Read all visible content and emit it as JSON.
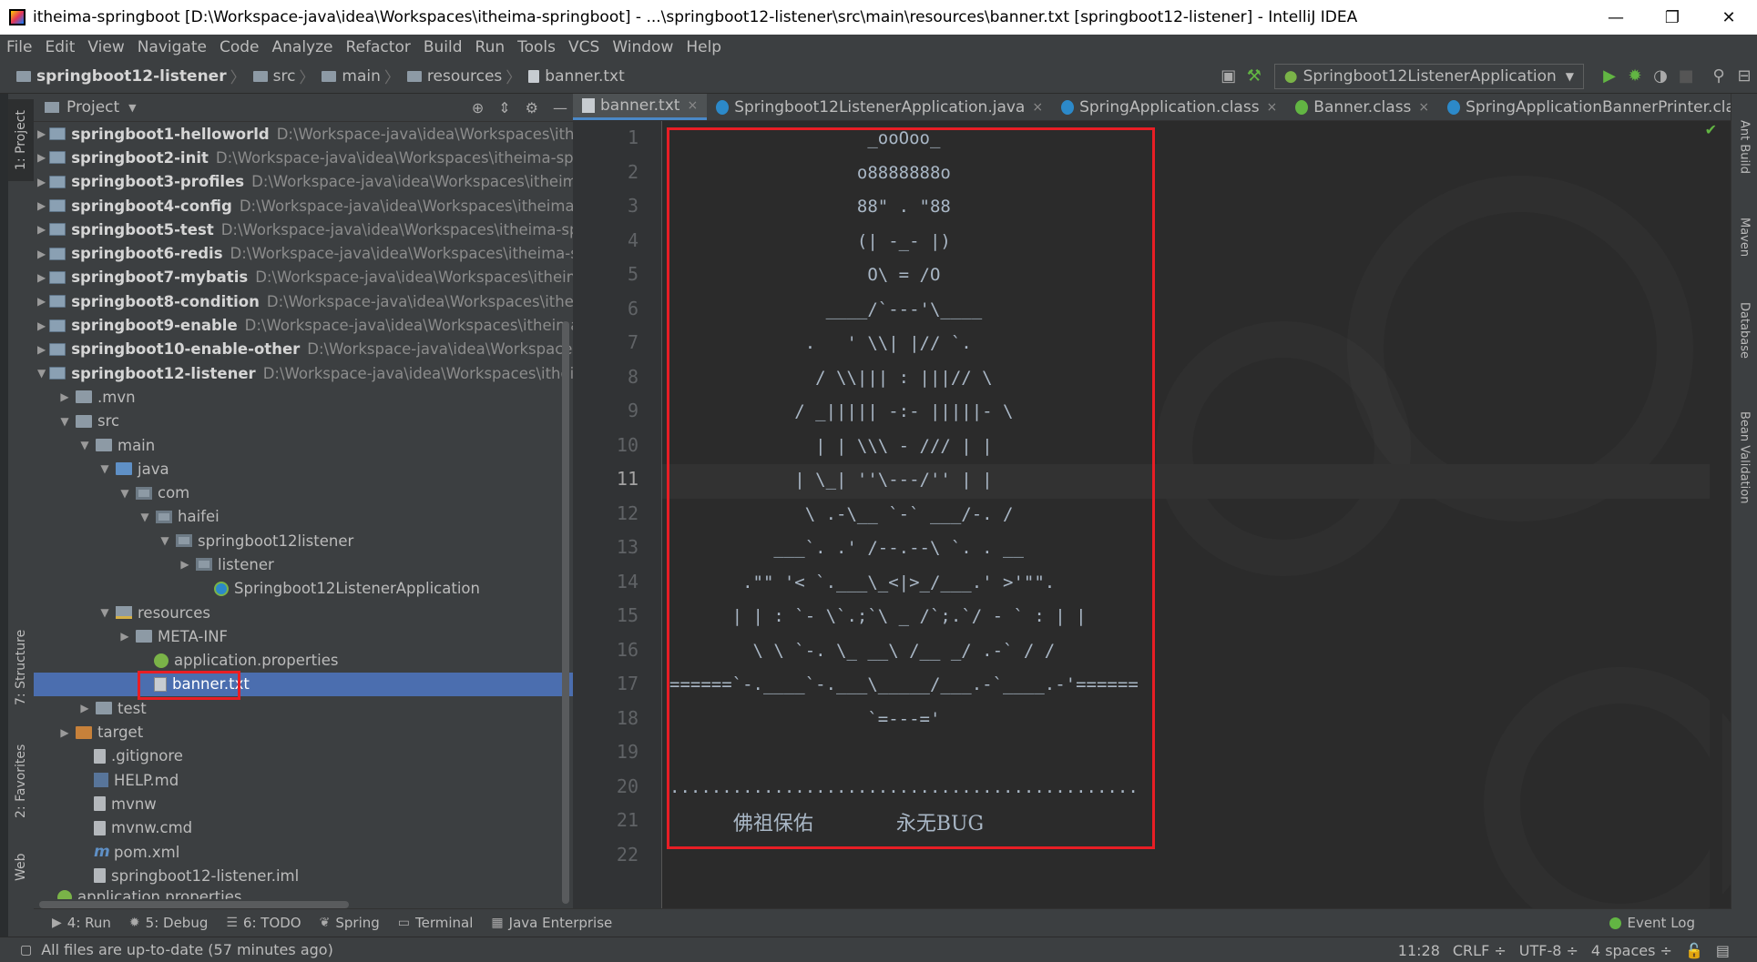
{
  "window": {
    "title": "itheima-springboot [D:\\Workspace-java\\idea\\Workspaces\\itheima-springboot] - ...\\springboot12-listener\\src\\main\\resources\\banner.txt [springboot12-listener] - IntelliJ IDEA",
    "minimize": "—",
    "maximize": "❐",
    "close": "✕"
  },
  "menu": [
    "File",
    "Edit",
    "View",
    "Navigate",
    "Code",
    "Analyze",
    "Refactor",
    "Build",
    "Run",
    "Tools",
    "VCS",
    "Window",
    "Help"
  ],
  "breadcrumbs": [
    "springboot12-listener",
    "src",
    "main",
    "resources",
    "banner.txt"
  ],
  "run_config": "Springboot12ListenerApplication",
  "left_tool_tabs": {
    "project": "1: Project",
    "structure": "7: Structure",
    "favorites": "2: Favorites",
    "web": "Web"
  },
  "right_tool_tabs": [
    "Ant Build",
    "Maven",
    "Database",
    "Bean Validation"
  ],
  "project_panel": {
    "title": "Project",
    "modules": [
      {
        "name": "springboot1-helloworld",
        "path": "D:\\Workspace-java\\idea\\Workspaces\\itheima-spri"
      },
      {
        "name": "springboot2-init",
        "path": "D:\\Workspace-java\\idea\\Workspaces\\itheima-springboot"
      },
      {
        "name": "springboot3-profiles",
        "path": "D:\\Workspace-java\\idea\\Workspaces\\itheima-springl"
      },
      {
        "name": "springboot4-config",
        "path": "D:\\Workspace-java\\idea\\Workspaces\\itheima-springb"
      },
      {
        "name": "springboot5-test",
        "path": "D:\\Workspace-java\\idea\\Workspaces\\itheima-springboo"
      },
      {
        "name": "springboot6-redis",
        "path": "D:\\Workspace-java\\idea\\Workspaces\\itheima-springboo"
      },
      {
        "name": "springboot7-mybatis",
        "path": "D:\\Workspace-java\\idea\\Workspaces\\itheima-spring"
      },
      {
        "name": "springboot8-condition",
        "path": "D:\\Workspace-java\\idea\\Workspaces\\itheima-sprir"
      },
      {
        "name": "springboot9-enable",
        "path": "D:\\Workspace-java\\idea\\Workspaces\\itheima-springb"
      },
      {
        "name": "springboot10-enable-other",
        "path": "D:\\Workspace-java\\idea\\Workspaces\\itheima-"
      },
      {
        "name": "springboot12-listener",
        "path": "D:\\Workspace-java\\idea\\Workspaces\\itheima-spring"
      }
    ],
    "files": {
      "mvn": ".mvn",
      "src": "src",
      "main": "main",
      "java": "java",
      "com": "com",
      "haifei": "haifei",
      "pkg": "springboot12listener",
      "listener": "listener",
      "app_class": "Springboot12ListenerApplication",
      "resources": "resources",
      "meta_inf": "META-INF",
      "app_props": "application.properties",
      "banner": "banner.txt",
      "test": "test",
      "target": "target",
      "gitignore": ".gitignore",
      "help": "HELP.md",
      "mvnw": "mvnw",
      "mvnw_cmd": "mvnw.cmd",
      "pom": "pom.xml",
      "iml": "springboot12-listener.iml",
      "partial": "application.properties"
    }
  },
  "editor_tabs": [
    {
      "label": "banner.txt",
      "active": true
    },
    {
      "label": "Springboot12ListenerApplication.java",
      "active": false
    },
    {
      "label": "SpringApplication.class",
      "active": false
    },
    {
      "label": "Banner.class",
      "active": false
    },
    {
      "label": "SpringApplicationBannerPrinter.class",
      "active": false
    }
  ],
  "tab_close": "×",
  "editor": {
    "current_line": 11,
    "line_numbers": [
      "1",
      "2",
      "3",
      "4",
      "5",
      "6",
      "7",
      "8",
      "9",
      "10",
      "11",
      "12",
      "13",
      "14",
      "15",
      "16",
      "17",
      "18",
      "19",
      "20",
      "21",
      "22"
    ],
    "lines": [
      "                   _ooOoo_",
      "                  o8888888o",
      "                  88\" . \"88",
      "                  (| -_- |)",
      "                   O\\ = /O",
      "               ____/`---'\\____",
      "             .   ' \\\\| |// `.",
      "              / \\\\||| : |||// \\",
      "            / _||||| -:- |||||- \\",
      "              | | \\\\\\ - /// | |",
      "            | \\_| ''\\---/'' | |",
      "             \\ .-\\__ `-` ___/-. /",
      "          ___`. .' /--.--\\ `. . __",
      "       .\"\" '< `.___\\_<|>_/___.' >'\"\".",
      "      | | : `- \\`.;`\\ _ /`;.`/ - ` : | |",
      "        \\ \\ `-. \\_ __\\ /__ _/ .-` / /",
      "======`-.____`-.___\\_____/___.-`____.-'======",
      "                   `=---='",
      "",
      ".............................................",
      "          佛祖保佑             永无BUG",
      ""
    ]
  },
  "bottom_tabs": [
    "4: Run",
    "5: Debug",
    "6: TODO",
    "Spring",
    "Terminal",
    "Java Enterprise"
  ],
  "event_log": "Event Log",
  "status": {
    "message": "All files are up-to-date (57 minutes ago)",
    "position": "11:28",
    "line_sep": "CRLF ÷",
    "encoding": "UTF-8 ÷",
    "indent": "4 spaces ÷"
  }
}
